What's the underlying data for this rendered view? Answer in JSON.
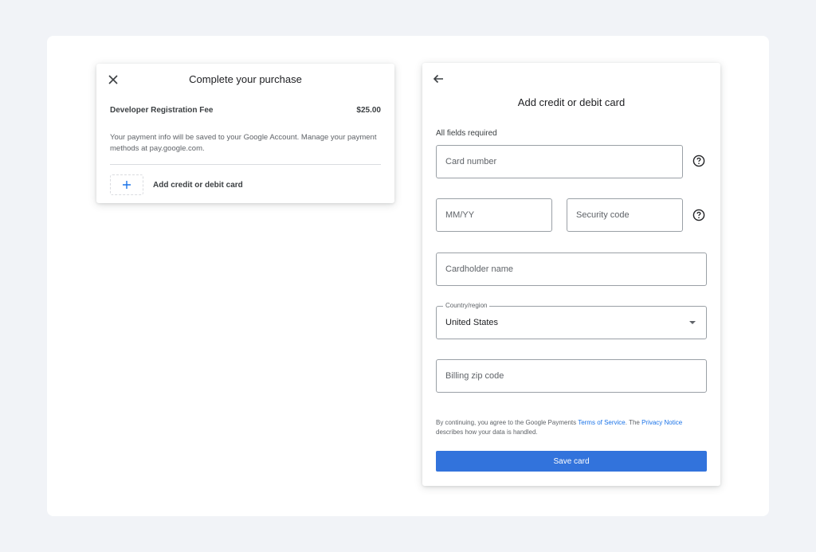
{
  "purchase_dialog": {
    "title": "Complete your purchase",
    "item_name": "Developer Registration Fee",
    "item_price": "$25.00",
    "info": "Your payment info will be saved to your Google Account. Manage your payment methods at pay.google.com.",
    "add_card_label": "Add credit or debit card",
    "close_icon": "close-icon",
    "add_icon": "plus-icon"
  },
  "add_card_form": {
    "title": "Add credit or debit card",
    "required_note": "All fields required",
    "back_icon": "arrow-left-icon",
    "card_number_placeholder": "Card number",
    "expiry_placeholder": "MM/YY",
    "security_code_placeholder": "Security code",
    "cardholder_placeholder": "Cardholder name",
    "country_label": "Country/region",
    "country_value": "United States",
    "zip_placeholder": "Billing zip code",
    "terms": {
      "part1": "By continuing, you agree to the Google Payments ",
      "tos_link": "Terms of Service",
      "part2": ". The ",
      "privacy_link": "Privacy Notice",
      "part3": " describes how your data is handled."
    },
    "save_label": "Save card",
    "help_icon": "help-circle-icon"
  },
  "colors": {
    "accent": "#3273dc",
    "link": "#1a73e8",
    "background": "#f1f3f7"
  }
}
